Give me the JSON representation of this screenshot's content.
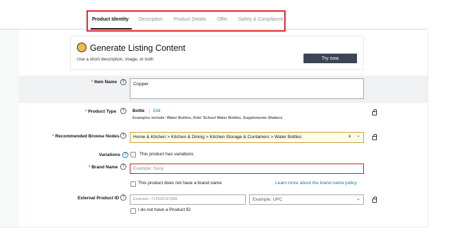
{
  "tabs": [
    {
      "label": "Product Identity"
    },
    {
      "label": "Description"
    },
    {
      "label": "Product Details"
    },
    {
      "label": "Offer"
    },
    {
      "label": "Safety & Compliance"
    }
  ],
  "generate_card": {
    "title": "Generate Listing Content",
    "subtitle": "Use a short description, image, or both",
    "button": "Try now"
  },
  "required_marker": "*",
  "help_glyph": "?",
  "item_name": {
    "label": "Item Name",
    "value": "Copper"
  },
  "product_type": {
    "label": "Product Type",
    "value": "Bottle",
    "separator": "|",
    "edit": "Edit",
    "examples_prefix": "Examples include:",
    "examples": "Water Bottles, Kids' School Water Bottles, Supplements Shakers"
  },
  "browse_nodes": {
    "label": "Recommended Browse Nodes",
    "value": "Home & Kitchen > Kitchen & Dining > Kitchen Storage & Containers > Water Bottles",
    "clear": "×",
    "chevron": "⌄"
  },
  "variations": {
    "label": "Variations",
    "checkbox": "This product has variations"
  },
  "brand": {
    "label": "Brand Name",
    "placeholder": "Example: Sony",
    "checkbox": "This product does not have a brand name",
    "link": "Learn more about the brand name policy"
  },
  "external_id": {
    "label": "External Product ID",
    "placeholder": "Example: 714532191586",
    "type_placeholder": "Example: UPC",
    "chevron": "⌄",
    "checkbox": "I do not have a Product ID"
  },
  "colors": {
    "highlight": "#e3242b",
    "link": "#0a7ba3",
    "button": "#3b4654",
    "error_border": "#cc1c1c"
  },
  "icons": [
    "help-icon",
    "lock-icon",
    "sparkle-icon",
    "chevron-down-icon",
    "close-icon"
  ]
}
